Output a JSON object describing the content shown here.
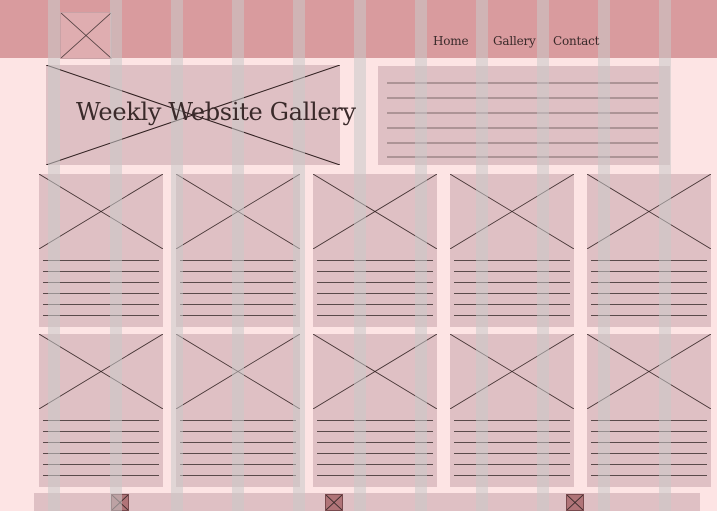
{
  "header": {
    "nav": [
      "Home",
      "Gallery",
      "Contact"
    ]
  },
  "hero": {
    "title": "Weekly Website Gallery"
  },
  "gallery": {
    "cards": 10,
    "lines_per_card": 6
  },
  "colors": {
    "header": "#d99b9e",
    "background": "#fde4e4",
    "placeholder": "#dfc0c4",
    "grid_column": "#c8c8c8"
  },
  "icons": [
    "logo-placeholder-icon",
    "image-placeholder-icon",
    "social-icon"
  ]
}
